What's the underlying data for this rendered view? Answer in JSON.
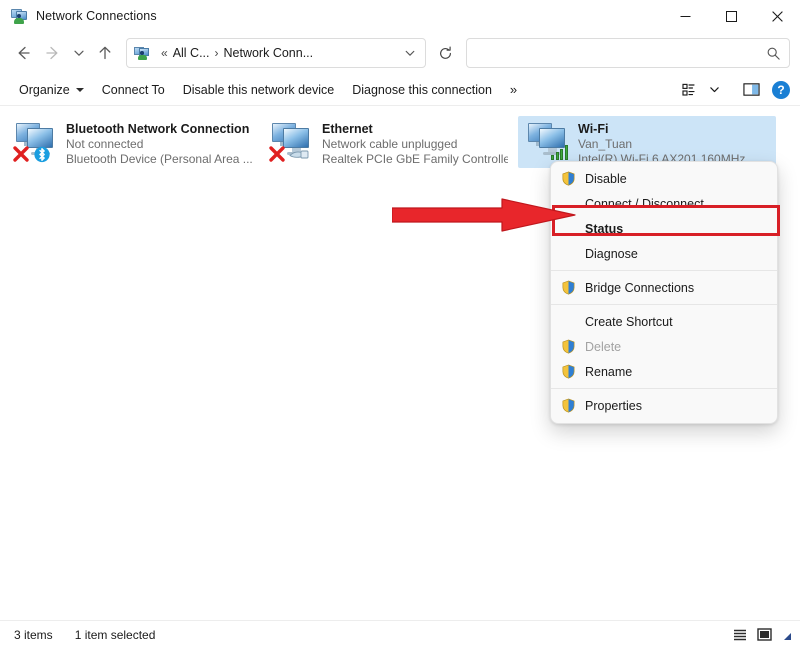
{
  "window": {
    "title": "Network Connections",
    "icon": "network-connections-icon",
    "minimize_label": "Minimize",
    "maximize_label": "Maximize",
    "close_label": "Close"
  },
  "nav": {
    "back_label": "Back",
    "forward_label": "Forward",
    "recent_label": "Recent locations",
    "up_label": "Up",
    "refresh_label": "Refresh",
    "breadcrumb": {
      "overflow": "«",
      "parent": "All C...",
      "separator": "›",
      "current": "Network Conn..."
    }
  },
  "search": {
    "placeholder": "",
    "value": "",
    "icon": "search-icon"
  },
  "toolbar": {
    "organize": "Organize",
    "connect_to": "Connect To",
    "disable_device": "Disable this network device",
    "diagnose_connection": "Diagnose this connection",
    "overflow": "»",
    "layout_label": "Change your view",
    "preview_label": "Preview pane",
    "help_label": "?"
  },
  "connections": [
    {
      "name": "Bluetooth Network Connection",
      "status": "Not connected",
      "device": "Bluetooth Device (Personal Area ...",
      "state": "disconnected",
      "badge": "bluetooth-icon",
      "selected": false
    },
    {
      "name": "Ethernet",
      "status": "Network cable unplugged",
      "device": "Realtek PCIe GbE Family Controller",
      "state": "unplugged",
      "badge": "ethernet-cable-icon",
      "selected": false
    },
    {
      "name": "Wi-Fi",
      "status": "Van_Tuan",
      "device": "Intel(R) Wi-Fi 6 AX201 160MHz",
      "state": "connected",
      "badge": "wifi-signal-icon",
      "selected": true
    }
  ],
  "context_menu": {
    "items": [
      {
        "label": "Disable",
        "icon": "shield-icon",
        "disabled": false,
        "bold": false,
        "separator_after": false
      },
      {
        "label": "Connect / Disconnect",
        "icon": "",
        "disabled": false,
        "bold": false,
        "separator_after": false
      },
      {
        "label": "Status",
        "icon": "",
        "disabled": false,
        "bold": true,
        "separator_after": false
      },
      {
        "label": "Diagnose",
        "icon": "",
        "disabled": false,
        "bold": false,
        "separator_after": true
      },
      {
        "label": "Bridge Connections",
        "icon": "shield-icon",
        "disabled": false,
        "bold": false,
        "separator_after": true
      },
      {
        "label": "Create Shortcut",
        "icon": "",
        "disabled": false,
        "bold": false,
        "separator_after": false
      },
      {
        "label": "Delete",
        "icon": "shield-icon",
        "disabled": true,
        "bold": false,
        "separator_after": false
      },
      {
        "label": "Rename",
        "icon": "shield-icon",
        "disabled": false,
        "bold": false,
        "separator_after": true
      },
      {
        "label": "Properties",
        "icon": "shield-icon",
        "disabled": false,
        "bold": false,
        "separator_after": false
      }
    ]
  },
  "annotation": {
    "highlight_target": "Status",
    "color": "#d81f26",
    "arrow": "right-arrow"
  },
  "statusbar": {
    "item_count": "3 items",
    "selection": "1 item selected",
    "details_view_label": "Details view",
    "large_icons_view_label": "Large icons view"
  },
  "colors": {
    "selection_blue": "#cce4f7",
    "accent_blue": "#1a7fd4",
    "annotation_red": "#d81f26",
    "error_red": "#e02020",
    "signal_green": "#3faa3f"
  }
}
